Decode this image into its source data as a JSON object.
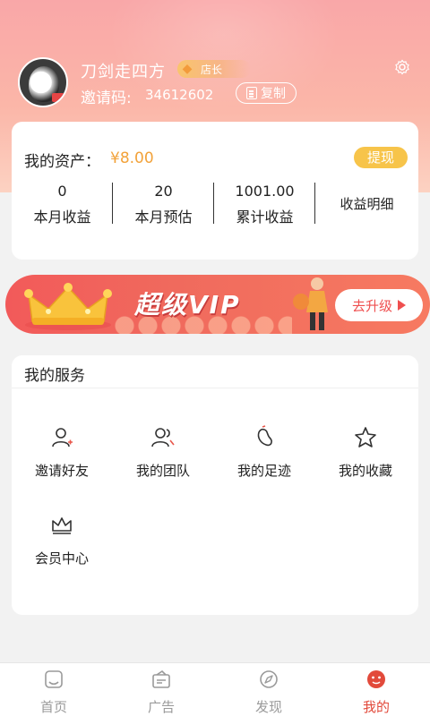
{
  "profile": {
    "username": "刀剑走四方",
    "rank": "店长",
    "invite_label": "邀请码:",
    "invite_code": "34612602",
    "copy_label": "复制"
  },
  "assets": {
    "label": "我的资产：",
    "value": "¥8.00",
    "withdraw_label": "提现",
    "stats": [
      {
        "value": "0",
        "label": "本月收益"
      },
      {
        "value": "20",
        "label": "本月预估"
      },
      {
        "value": "1001.00",
        "label": "累计收益"
      }
    ],
    "detail_label": "收益明细"
  },
  "vip_banner": {
    "title": "超级VIP",
    "upgrade_label": "去升级"
  },
  "services": {
    "title": "我的服务",
    "items": [
      {
        "label": "邀请好友",
        "icon": "invite-friend-icon"
      },
      {
        "label": "我的团队",
        "icon": "team-icon"
      },
      {
        "label": "我的足迹",
        "icon": "footprint-icon"
      },
      {
        "label": "我的收藏",
        "icon": "star-icon"
      },
      {
        "label": "会员中心",
        "icon": "crown-icon"
      }
    ]
  },
  "tabbar": {
    "tabs": [
      {
        "label": "首页",
        "icon": "home-icon"
      },
      {
        "label": "广告",
        "icon": "ad-icon"
      },
      {
        "label": "发现",
        "icon": "compass-icon"
      },
      {
        "label": "我的",
        "icon": "profile-icon",
        "active": true
      }
    ]
  },
  "colors": {
    "header_gradient": "#f9a7a8",
    "accent_gold": "#f7c44a",
    "price_orange": "#f2a23a",
    "vip_red": "#f25a5a",
    "active_tab": "#e24a3b"
  }
}
